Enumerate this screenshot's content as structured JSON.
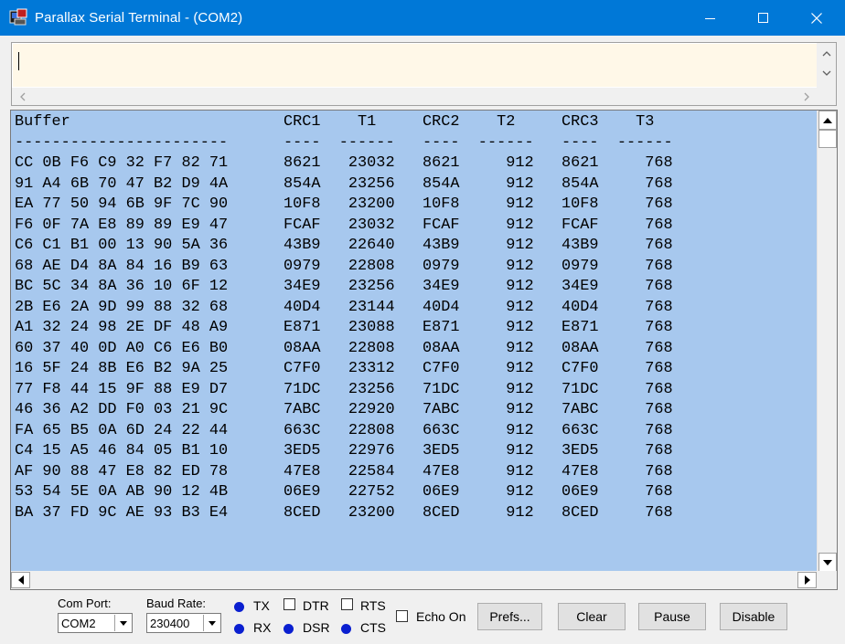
{
  "window": {
    "title": "Parallax Serial Terminal - (COM2)",
    "icon": "terminal-app-icon",
    "controls": [
      "minimize-icon",
      "maximize-icon",
      "close-icon"
    ]
  },
  "input": {
    "value": ""
  },
  "terminal": {
    "text": "Buffer                       CRC1    T1     CRC2    T2     CRC3    T3\n-----------------------      ----  ------   ----  ------   ----  ------\nCC 0B F6 C9 32 F7 82 71      8621   23032   8621     912   8621     768\n91 A4 6B 70 47 B2 D9 4A      854A   23256   854A     912   854A     768\nEA 77 50 94 6B 9F 7C 90      10F8   23200   10F8     912   10F8     768\nF6 0F 7A E8 89 89 E9 47      FCAF   23032   FCAF     912   FCAF     768\nC6 C1 B1 00 13 90 5A 36      43B9   22640   43B9     912   43B9     768\n68 AE D4 8A 84 16 B9 63      0979   22808   0979     912   0979     768\nBC 5C 34 8A 36 10 6F 12      34E9   23256   34E9     912   34E9     768\n2B E6 2A 9D 99 88 32 68      40D4   23144   40D4     912   40D4     768\nA1 32 24 98 2E DF 48 A9      E871   23088   E871     912   E871     768\n60 37 40 0D A0 C6 E6 B0      08AA   22808   08AA     912   08AA     768\n16 5F 24 8B E6 B2 9A 25      C7F0   23312   C7F0     912   C7F0     768\n77 F8 44 15 9F 88 E9 D7      71DC   23256   71DC     912   71DC     768\n46 36 A2 DD F0 03 21 9C      7ABC   22920   7ABC     912   7ABC     768\nFA 65 B5 0A 6D 24 22 44      663C   22808   663C     912   663C     768\nC4 15 A5 46 84 05 B1 10      3ED5   22976   3ED5     912   3ED5     768\nAF 90 88 47 E8 82 ED 78      47E8   22584   47E8     912   47E8     768\n53 54 5E 0A AB 90 12 4B      06E9   22752   06E9     912   06E9     768\nBA 37 FD 9C AE 93 B3 E4      8CED   23200   8CED     912   8CED     768",
    "background": "#a7c8ee"
  },
  "controls": {
    "com_port_label": "Com Port:",
    "com_port_value": "COM2",
    "baud_rate_label": "Baud Rate:",
    "baud_rate_value": "230400",
    "tx_label": "TX",
    "rx_label": "RX",
    "dtr_label": "DTR",
    "dsr_label": "DSR",
    "rts_label": "RTS",
    "cts_label": "CTS",
    "echo_label": "Echo On",
    "prefs_label": "Prefs...",
    "clear_label": "Clear",
    "pause_label": "Pause",
    "disable_label": "Disable",
    "indicator_color": "#0a1fd0"
  }
}
